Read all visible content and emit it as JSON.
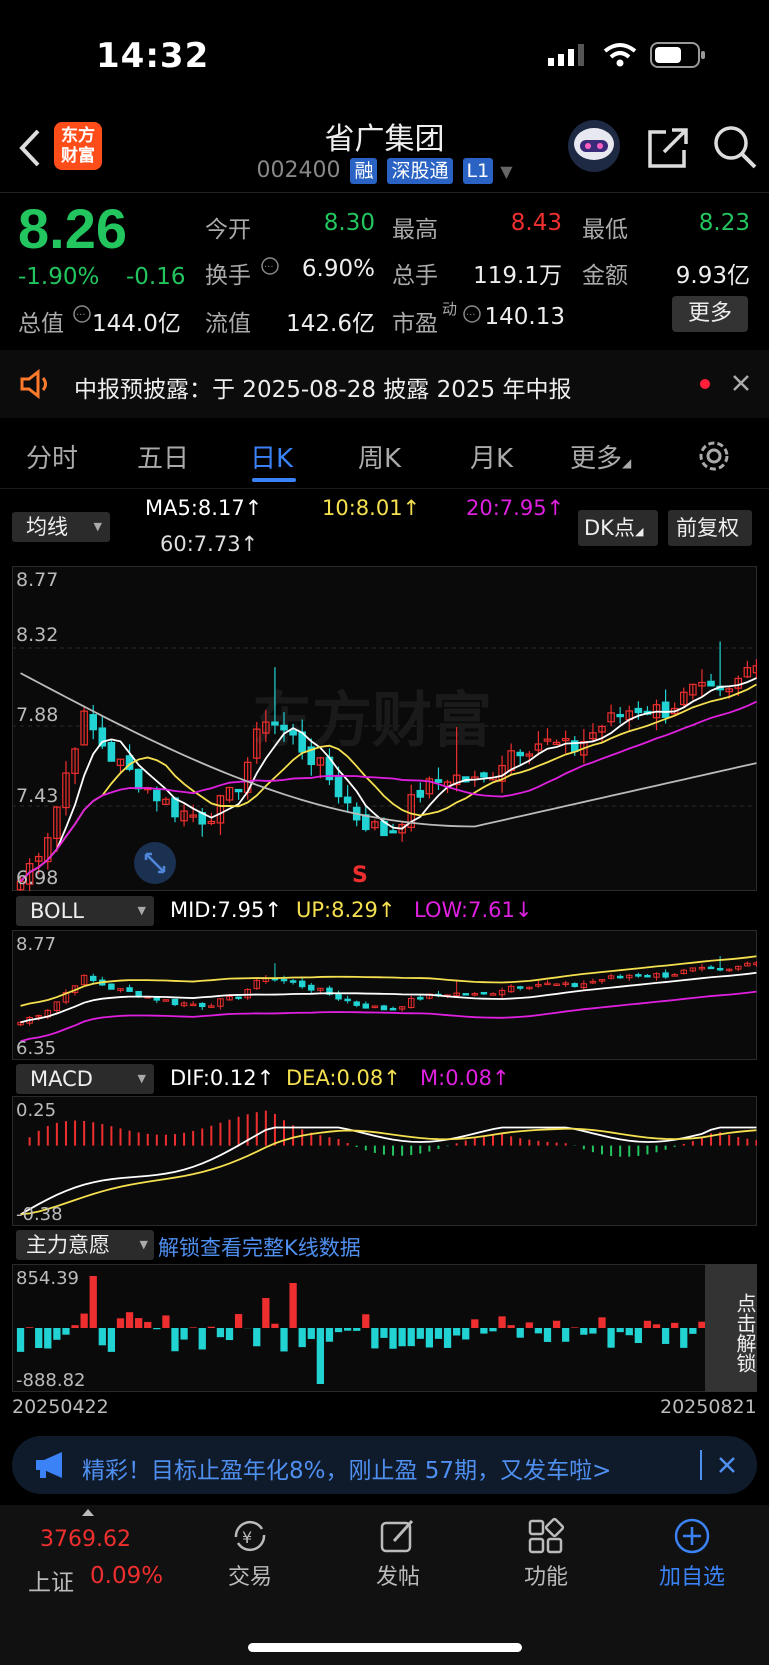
{
  "status": {
    "time": "14:32"
  },
  "header": {
    "logo_text": "东方财富",
    "title": "省广集团",
    "code": "002400",
    "tags": [
      "融",
      "深股通",
      "L1"
    ]
  },
  "quote": {
    "price": "8.26",
    "change_pct": "-1.90%",
    "change": "-0.16",
    "open_label": "今开",
    "open": "8.30",
    "high_label": "最高",
    "high": "8.43",
    "low_label": "最低",
    "low": "8.23",
    "turnover_label": "换手",
    "turnover": "6.90%",
    "volume_label": "总手",
    "volume": "119.1万",
    "amount_label": "金额",
    "amount": "9.93亿",
    "mcap_label": "总值",
    "mcap": "144.0亿",
    "float_label": "流值",
    "float": "142.6亿",
    "pe_label": "市盈",
    "pe_sup": "动",
    "pe": "140.13",
    "more": "更多"
  },
  "notice": {
    "text": "中报预披露：于 2025-08-28 披露 2025 年中报"
  },
  "tabs": [
    "分时",
    "五日",
    "日K",
    "周K",
    "月K",
    "更多"
  ],
  "active_tab": "日K",
  "kline": {
    "selector": "均线",
    "ma5": "MA5:8.17↑",
    "ma10": "10:8.01↑",
    "ma20": "20:7.95↑",
    "ma60": "60:7.73↑",
    "dk_btn": "DK点",
    "fq_btn": "前复权",
    "axis": [
      "8.77",
      "8.32",
      "7.88",
      "7.43",
      "6.98"
    ],
    "marker": "S",
    "watermark": "东方财富"
  },
  "boll": {
    "selector": "BOLL",
    "mid": "MID:7.95↑",
    "up": "UP:8.29↑",
    "low": "LOW:7.61↓",
    "axis_top": "8.77",
    "axis_bottom": "6.35"
  },
  "macd": {
    "selector": "MACD",
    "dif": "DIF:0.12↑",
    "dea": "DEA:0.08↑",
    "m": "M:0.08↑",
    "axis_top": "0.25",
    "axis_bottom": "-0.38"
  },
  "zhuli": {
    "selector": "主力意愿",
    "unlock": "解锁查看完整K线数据",
    "axis_top": "854.39",
    "axis_bottom": "-888.82",
    "side_btn": "点击解锁"
  },
  "dates": {
    "start": "20250422",
    "end": "20250821"
  },
  "promo": {
    "text": "精彩！目标止盈年化8%，刚止盈 57期，又发车啦>"
  },
  "bottom": {
    "index_value": "3769.62",
    "index_name": "上证",
    "index_change": "0.09%",
    "nav": [
      "交易",
      "发帖",
      "功能",
      "加自选"
    ]
  },
  "colors": {
    "up": "#ef2f2f",
    "down": "#22c55e",
    "accent": "#3b82f6",
    "ma5": "#ffffff",
    "ma10": "#f5e050",
    "ma20": "#e020e0",
    "ma60": "#bbbbbb"
  }
}
